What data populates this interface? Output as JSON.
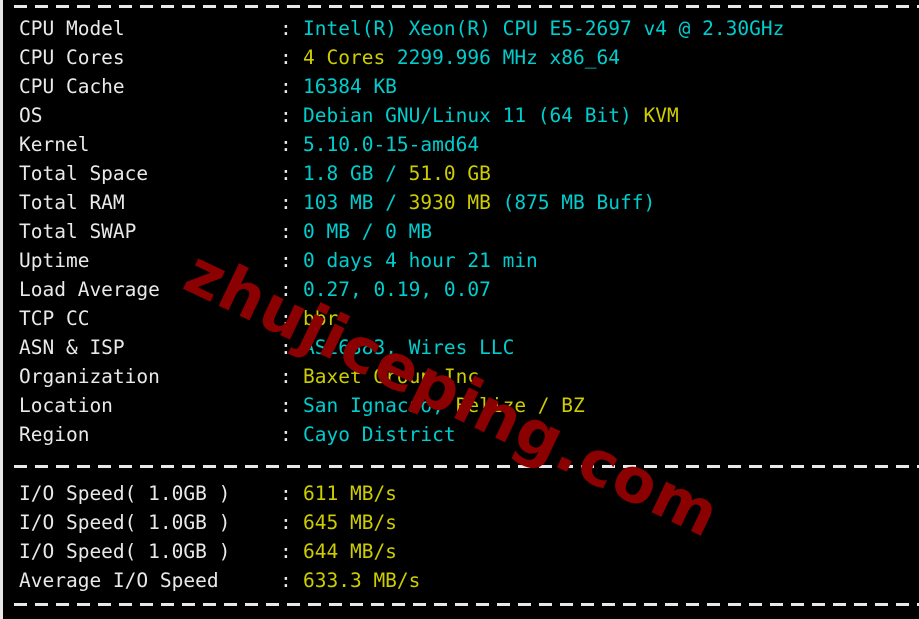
{
  "terminal": {
    "background_color": "#000000",
    "default_text_color": "#e9e9e9",
    "value_color": "#00cdcd",
    "highlight_color": "#cdcd00",
    "watermark_color": "#8b0000",
    "separator_char": "-"
  },
  "watermark": {
    "text": "zhujiceping.com"
  },
  "separators": {
    "top": "-----------------------------------------------------------------------------",
    "middle": "-----------------------------------------------------------------------------",
    "bottom": "-----------------------------------------------------------------------------"
  },
  "system_info": {
    "rows": [
      {
        "label": "CPU Model",
        "colon": ":",
        "segments": [
          {
            "text": "Intel(R) Xeon(R) CPU E5-2697 v4 @ 2.30GHz",
            "color": "cyan"
          }
        ],
        "value_plain": "Intel(R) Xeon(R) CPU E5-2697 v4 @ 2.30GHz"
      },
      {
        "label": "CPU Cores",
        "colon": ":",
        "segments": [
          {
            "text": "4 Cores",
            "color": "yellow"
          },
          {
            "text": " 2299.996 MHz x86_64",
            "color": "cyan"
          }
        ],
        "value_plain": "4 Cores 2299.996 MHz x86_64"
      },
      {
        "label": "CPU Cache",
        "colon": ":",
        "segments": [
          {
            "text": "16384 KB",
            "color": "cyan"
          }
        ],
        "value_plain": "16384 KB"
      },
      {
        "label": "OS",
        "colon": ":",
        "segments": [
          {
            "text": "Debian GNU/Linux 11 (64 Bit)",
            "color": "cyan"
          },
          {
            "text": " KVM",
            "color": "yellow"
          }
        ],
        "value_plain": "Debian GNU/Linux 11 (64 Bit) KVM"
      },
      {
        "label": "Kernel",
        "colon": ":",
        "segments": [
          {
            "text": "5.10.0-15-amd64",
            "color": "cyan"
          }
        ],
        "value_plain": "5.10.0-15-amd64"
      },
      {
        "label": "Total Space",
        "colon": ":",
        "segments": [
          {
            "text": "1.8 GB ",
            "color": "cyan"
          },
          {
            "text": "/",
            "color": "cyan"
          },
          {
            "text": " 51.0 GB",
            "color": "yellow"
          }
        ],
        "value_plain": "1.8 GB / 51.0 GB"
      },
      {
        "label": "Total RAM",
        "colon": ":",
        "segments": [
          {
            "text": "103 MB ",
            "color": "cyan"
          },
          {
            "text": "/",
            "color": "cyan"
          },
          {
            "text": " 3930 MB",
            "color": "yellow"
          },
          {
            "text": " (875 MB Buff)",
            "color": "cyan"
          }
        ],
        "value_plain": "103 MB / 3930 MB (875 MB Buff)"
      },
      {
        "label": "Total SWAP",
        "colon": ":",
        "segments": [
          {
            "text": "0 MB / 0 MB",
            "color": "cyan"
          }
        ],
        "value_plain": "0 MB / 0 MB"
      },
      {
        "label": "Uptime",
        "colon": ":",
        "segments": [
          {
            "text": "0 days 4 hour 21 min",
            "color": "cyan"
          }
        ],
        "value_plain": "0 days 4 hour 21 min"
      },
      {
        "label": "Load Average",
        "colon": ":",
        "segments": [
          {
            "text": "0.27, 0.19, 0.07",
            "color": "cyan"
          }
        ],
        "value_plain": "0.27, 0.19, 0.07"
      },
      {
        "label": "TCP CC",
        "colon": ":",
        "segments": [
          {
            "text": "bbr",
            "color": "yellow"
          }
        ],
        "value_plain": "bbr"
      },
      {
        "label": "ASN & ISP",
        "colon": ":",
        "segments": [
          {
            "text": "AS26383, Wires LLC",
            "color": "cyan"
          }
        ],
        "value_plain": "AS26383, Wires LLC"
      },
      {
        "label": "Organization",
        "colon": ":",
        "segments": [
          {
            "text": "Baxet Group Inc",
            "color": "yellow"
          }
        ],
        "value_plain": "Baxet Group Inc"
      },
      {
        "label": "Location",
        "colon": ":",
        "segments": [
          {
            "text": "San Ignacio,",
            "color": "cyan"
          },
          {
            "text": " Belize / BZ",
            "color": "yellow"
          }
        ],
        "value_plain": "San Ignacio, Belize / BZ"
      },
      {
        "label": "Region",
        "colon": ":",
        "segments": [
          {
            "text": "Cayo District",
            "color": "cyan"
          }
        ],
        "value_plain": "Cayo District"
      }
    ]
  },
  "io_benchmark": {
    "rows": [
      {
        "label": "I/O Speed( 1.0GB )",
        "colon": ":",
        "segments": [
          {
            "text": "611 MB/s",
            "color": "yellow"
          }
        ],
        "value_plain": "611 MB/s"
      },
      {
        "label": "I/O Speed( 1.0GB )",
        "colon": ":",
        "segments": [
          {
            "text": "645 MB/s",
            "color": "yellow"
          }
        ],
        "value_plain": "645 MB/s"
      },
      {
        "label": "I/O Speed( 1.0GB )",
        "colon": ":",
        "segments": [
          {
            "text": "644 MB/s",
            "color": "yellow"
          }
        ],
        "value_plain": "644 MB/s"
      },
      {
        "label": "Average I/O Speed",
        "colon": ":",
        "segments": [
          {
            "text": "633.3 MB/s",
            "color": "yellow"
          }
        ],
        "value_plain": "633.3 MB/s"
      }
    ]
  }
}
